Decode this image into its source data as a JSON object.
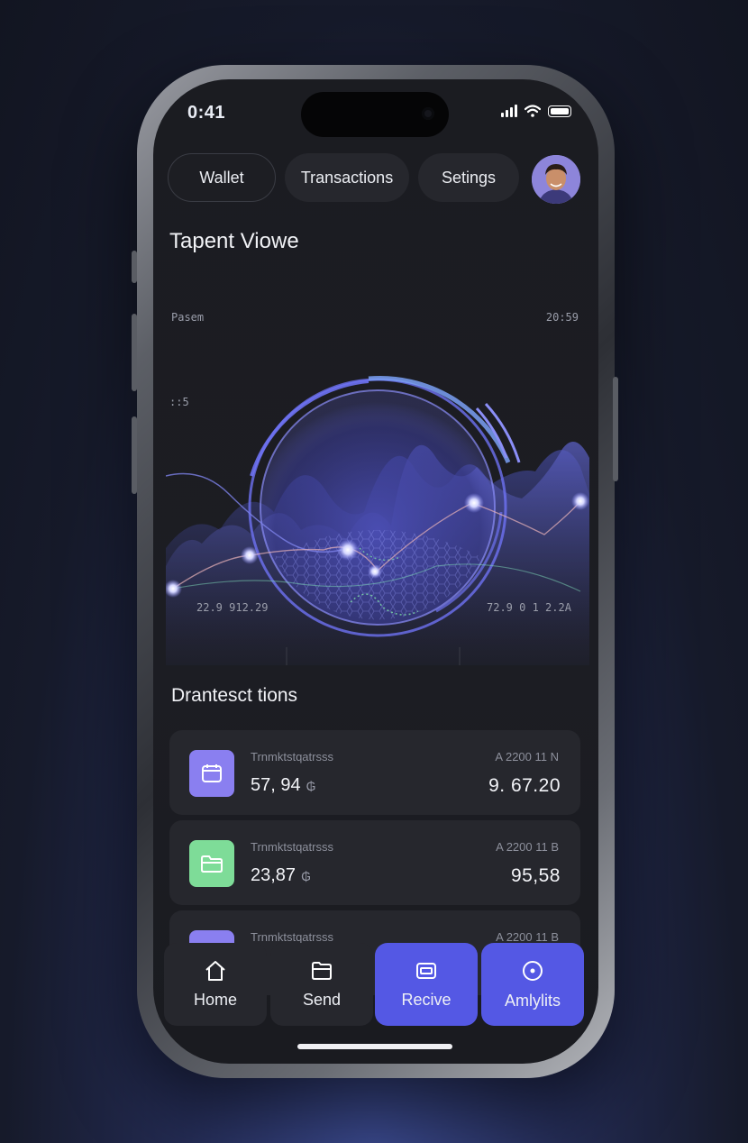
{
  "status_bar": {
    "time": "0:41"
  },
  "top_nav": {
    "tabs": [
      {
        "label": "Wallet",
        "active": true
      },
      {
        "label": "Transactions",
        "active": false
      },
      {
        "label": "Setings",
        "active": false
      }
    ],
    "avatar_icon": "user-avatar"
  },
  "hero": {
    "title": "Tapent Viowe",
    "chart_labels": {
      "top_left": "Pasem",
      "top_right": "20:59",
      "mid_left": "::5",
      "bottom_left": "22.9 912.29",
      "bottom_right": "72.9 0 1 2.2A"
    },
    "accent_color": "#6b6cf0"
  },
  "transactions": {
    "title": "Drantesct tions",
    "items": [
      {
        "label": "Trnmktstqatrsss",
        "amount": "57, 94",
        "currency": "₲",
        "date": "A 2200 11 N",
        "value": "9. 67.20",
        "icon": "calendar-icon",
        "icon_bg": "#8a7ff0"
      },
      {
        "label": "Trnmktstqatrsss",
        "amount": "23,87",
        "currency": "₲",
        "date": "A 2200 11 B",
        "value": "95,58",
        "icon": "folder-icon",
        "icon_bg": "#7edc98"
      },
      {
        "label": "Trnmktstqatrsss",
        "amount": "",
        "currency": "",
        "date": "A 2200 11 B",
        "value": "",
        "icon": "card-icon",
        "icon_bg": "#8a7ff0"
      }
    ]
  },
  "bottom_nav": {
    "tabs": [
      {
        "label": "Home",
        "icon": "home-icon",
        "active": false
      },
      {
        "label": "Send",
        "icon": "folder-icon",
        "active": false
      },
      {
        "label": "Recive",
        "icon": "wallet-icon",
        "active": true
      },
      {
        "label": "Amlylits",
        "icon": "chart-icon",
        "active": true
      }
    ]
  }
}
